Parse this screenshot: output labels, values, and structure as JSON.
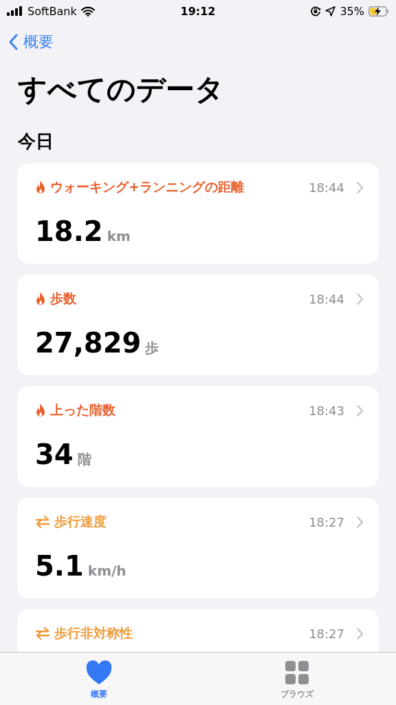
{
  "status_bar": {
    "carrier": "SoftBank",
    "time": "19:12",
    "battery": "35%"
  },
  "nav": {
    "back": "概要"
  },
  "title": "すべてのデータ",
  "section": "今日",
  "metrics": [
    {
      "kind": "flame",
      "color": "#e8602c",
      "name": "ウォーキング+ランニングの距離",
      "time": "18:44",
      "value": "18.2",
      "unit": "km"
    },
    {
      "kind": "flame",
      "color": "#e8602c",
      "name": "歩数",
      "time": "18:44",
      "value": "27,829",
      "unit": "歩"
    },
    {
      "kind": "flame",
      "color": "#e8602c",
      "name": "上った階数",
      "time": "18:43",
      "value": "34",
      "unit": "階"
    },
    {
      "kind": "arrows",
      "color": "#f09a37",
      "name": "歩行速度",
      "time": "18:27",
      "value": "5.1",
      "unit": "km/h"
    },
    {
      "kind": "arrows",
      "color": "#f09a37",
      "name": "歩行非対称性",
      "time": "18:27"
    }
  ],
  "tabs": [
    {
      "kind": "heart",
      "label": "概要",
      "selected": true
    },
    {
      "kind": "grid",
      "label": "ブラウズ",
      "selected": false
    }
  ]
}
